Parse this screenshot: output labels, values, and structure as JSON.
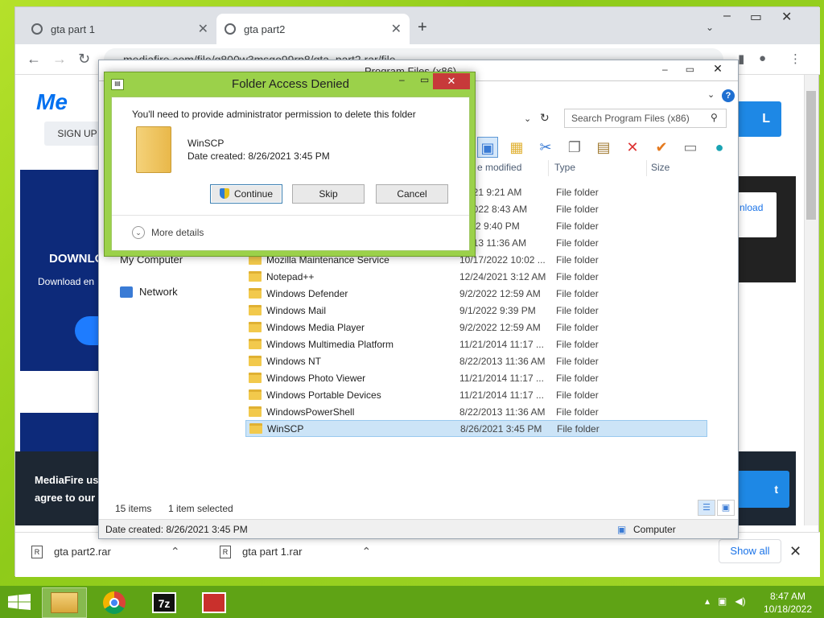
{
  "browser": {
    "tabs": [
      {
        "title": "gta part 1"
      },
      {
        "title": "gta part2"
      }
    ],
    "url": "mediafire.com/file/q800w3msgo99rp8/gta_part2.rar/file"
  },
  "page": {
    "logo": "Me",
    "signup": "SIGN UP",
    "left_heading": "DOWNLO",
    "left_text": "Download en",
    "right_btn": "L",
    "right_link": "nload",
    "cookie_line1": "MediaFire use",
    "cookie_line2": "agree to our P",
    "cookie_btn": "t"
  },
  "downloads": {
    "items": [
      {
        "name": "gta part2.rar"
      },
      {
        "name": "gta part 1.rar"
      }
    ],
    "show_all": "Show all"
  },
  "explorer": {
    "title": "Program Files (x86)",
    "search_placeholder": "Search Program Files (x86)",
    "columns": {
      "date": "e modified",
      "type": "Type",
      "size": "Size"
    },
    "nav": {
      "computer": "My Computer",
      "network": "Network"
    },
    "rows": [
      {
        "name": "",
        "date": "/2021 9:21 AM",
        "type": "File folder"
      },
      {
        "name": "",
        "date": "8/2022 8:43 AM",
        "type": "File folder"
      },
      {
        "name": "",
        "date": "2022 9:40 PM",
        "type": "File folder"
      },
      {
        "name": "",
        "date": "/2013 11:36 AM",
        "type": "File folder"
      },
      {
        "name": "Mozilla Maintenance Service",
        "date": "10/17/2022 10:02 ...",
        "type": "File folder"
      },
      {
        "name": "Notepad++",
        "date": "12/24/2021 3:12 AM",
        "type": "File folder"
      },
      {
        "name": "Windows Defender",
        "date": "9/2/2022 12:59 AM",
        "type": "File folder"
      },
      {
        "name": "Windows Mail",
        "date": "9/1/2022 9:39 PM",
        "type": "File folder"
      },
      {
        "name": "Windows Media Player",
        "date": "9/2/2022 12:59 AM",
        "type": "File folder"
      },
      {
        "name": "Windows Multimedia Platform",
        "date": "11/21/2014 11:17 ...",
        "type": "File folder"
      },
      {
        "name": "Windows NT",
        "date": "8/22/2013 11:36 AM",
        "type": "File folder"
      },
      {
        "name": "Windows Photo Viewer",
        "date": "11/21/2014 11:17 ...",
        "type": "File folder"
      },
      {
        "name": "Windows Portable Devices",
        "date": "11/21/2014 11:17 ...",
        "type": "File folder"
      },
      {
        "name": "WindowsPowerShell",
        "date": "8/22/2013 11:36 AM",
        "type": "File folder"
      },
      {
        "name": "WinSCP",
        "date": "8/26/2021 3:45 PM",
        "type": "File folder"
      }
    ],
    "status_items": "15 items",
    "status_selected": "1 item selected",
    "status_date": "Date created: 8/26/2021 3:45 PM",
    "status_location": "Computer"
  },
  "dialog": {
    "title": "Folder Access Denied",
    "message": "You'll need to provide administrator permission to delete this folder",
    "item_name": "WinSCP",
    "item_date": "Date created: 8/26/2021 3:45 PM",
    "continue": "Continue",
    "skip": "Skip",
    "cancel": "Cancel",
    "more_details": "More details"
  },
  "taskbar": {
    "time": "8:47 AM",
    "date": "10/18/2022",
    "sevenzip": "7z"
  }
}
